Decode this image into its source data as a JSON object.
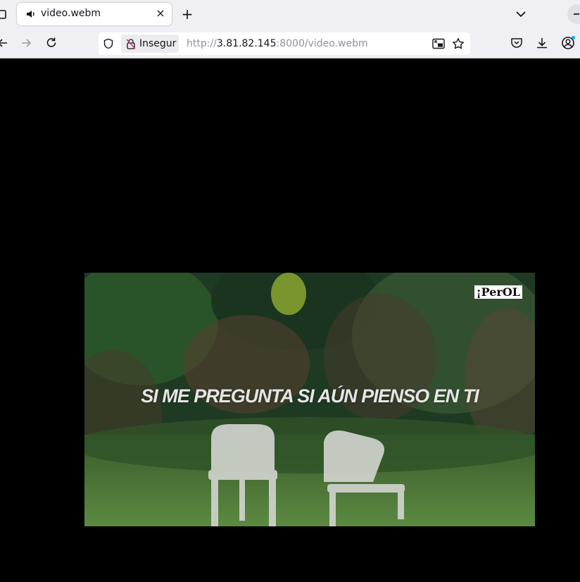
{
  "tab": {
    "title": "video.webm",
    "close": "×"
  },
  "tabbar": {
    "new_tab": "+"
  },
  "urlbar": {
    "security_label": "Insegur",
    "url_scheme": "http://",
    "url_host": "3.81.82.145",
    "url_rest": ":8000/video.webm"
  },
  "video": {
    "subtitle": "SI ME PREGUNTA SI AÚN PIENSO EN TI",
    "logo_text": "¡PerOL"
  },
  "icons": {
    "tab_audio": "speaker-icon",
    "list_tabs": "chevron-down-icon",
    "back": "arrow-left-icon",
    "forward": "arrow-right-icon",
    "reload": "reload-icon",
    "tracking": "shield-icon",
    "insecure": "insecure-lock-icon",
    "pip": "picture-in-picture-icon",
    "bookmark": "star-icon",
    "pocket": "pocket-icon",
    "downloads": "download-icon",
    "account": "account-icon"
  },
  "colors": {
    "chrome_bg": "#f0f0f4",
    "url_text": "#8f8f9d",
    "page_bg": "#000000"
  }
}
